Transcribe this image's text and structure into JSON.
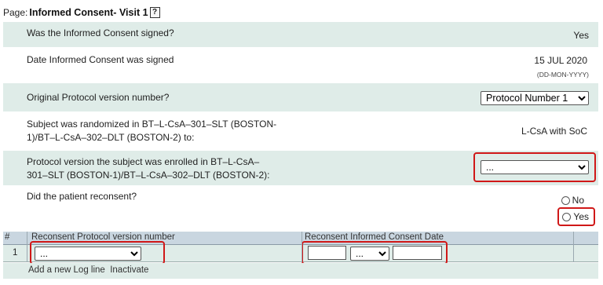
{
  "page": {
    "label": "Page:",
    "title": "Informed Consent- Visit 1",
    "help": "?"
  },
  "questions": {
    "q1": {
      "text": "Was the Informed Consent signed?",
      "answer": "Yes"
    },
    "q2": {
      "text": "Date Informed Consent was signed",
      "answer": "15 JUL 2020",
      "format": "(DD-MON-YYYY)"
    },
    "q3": {
      "text": "Original Protocol version number?",
      "selected": "Protocol Number 1"
    },
    "q4": {
      "line1": "Subject was randomized in BT–L-CsA–301–SLT (BOSTON-",
      "line2": "1)/BT–L-CsA–302–DLT (BOSTON-2) to:",
      "answer": "L-CsA with SoC"
    },
    "q5": {
      "line1": "Protocol version the subject was enrolled in BT–L-CsA–",
      "line2": "301–SLT (BOSTON-1)/BT–L-CsA–302–DLT (BOSTON-2):",
      "selected": "..."
    },
    "q6": {
      "text": "Did the patient reconsent?",
      "opt_no": "No",
      "opt_yes": "Yes"
    }
  },
  "log": {
    "col_num": "#",
    "col_version": "Reconsent Protocol version number",
    "col_date": "Reconsent Informed Consent Date",
    "row_num": "1",
    "version_selected": "...",
    "month_selected": "...",
    "footer": "Add a new Log line  Inactivate"
  },
  "colors": {
    "row_shade": "#dfece8",
    "header_shade": "#c9d6e0",
    "highlight": "#d01818"
  }
}
